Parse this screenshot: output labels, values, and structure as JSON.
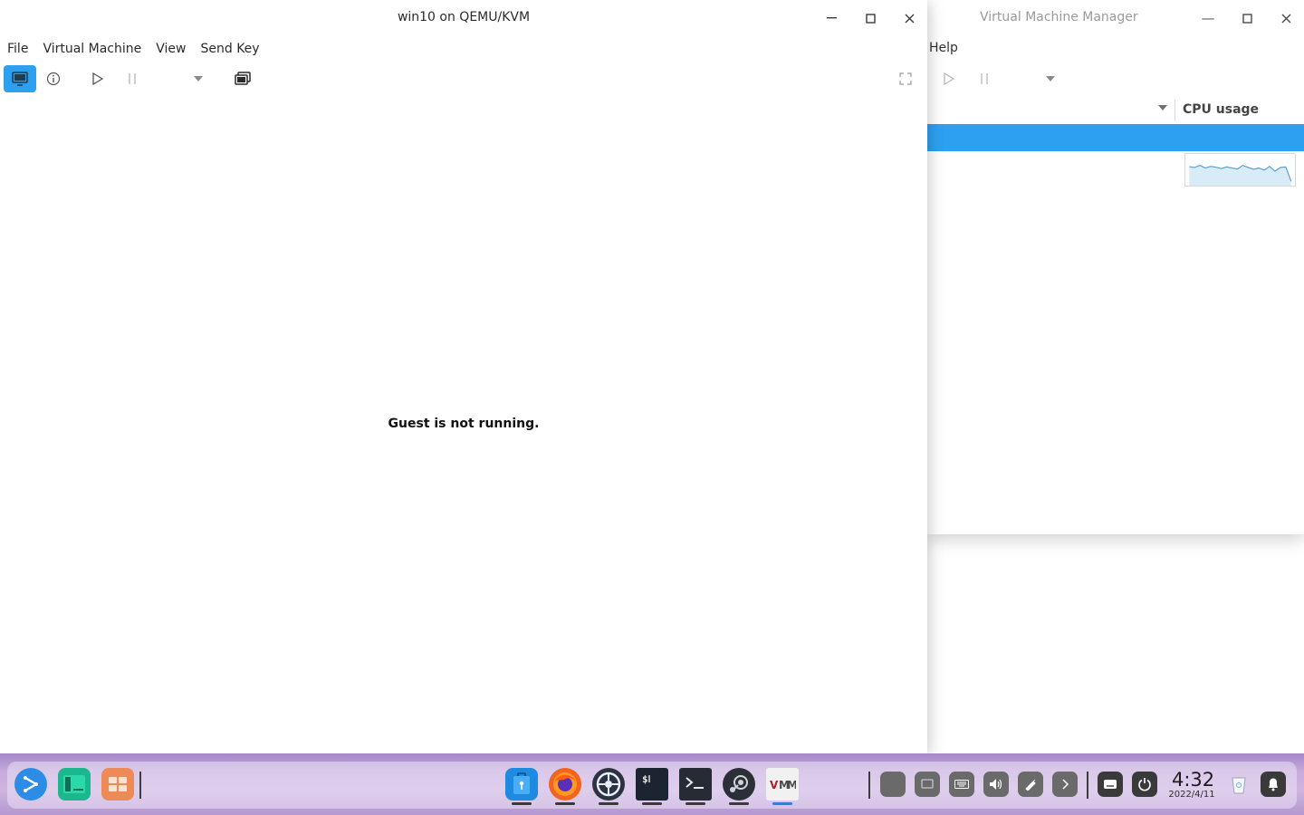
{
  "viewer": {
    "title": "win10 on QEMU/KVM",
    "menus": [
      "File",
      "Virtual Machine",
      "View",
      "Send Key"
    ],
    "message": "Guest is not running."
  },
  "manager": {
    "title": "Virtual Machine Manager",
    "menu_help": "Help",
    "column_header": "CPU usage",
    "cpu_history": [
      0.65,
      0.62,
      0.7,
      0.6,
      0.66,
      0.63,
      0.58,
      0.64,
      0.6,
      0.56,
      0.7,
      0.62,
      0.55,
      0.6,
      0.52,
      0.66,
      0.48,
      0.62,
      0.64,
      0.1
    ]
  },
  "taskbar": {
    "clock_time": "4:32",
    "clock_date": "2022/4/11",
    "apps": [
      "launcher-icon",
      "file-manager-icon",
      "app-store-icon",
      "finder-icon",
      "firefox-icon",
      "settings-icon",
      "terminal-icon",
      "console-icon",
      "steam-icon",
      "virt-manager-icon"
    ]
  },
  "colors": {
    "accent": "#2ea0f0",
    "dock": "#c6abdc"
  }
}
